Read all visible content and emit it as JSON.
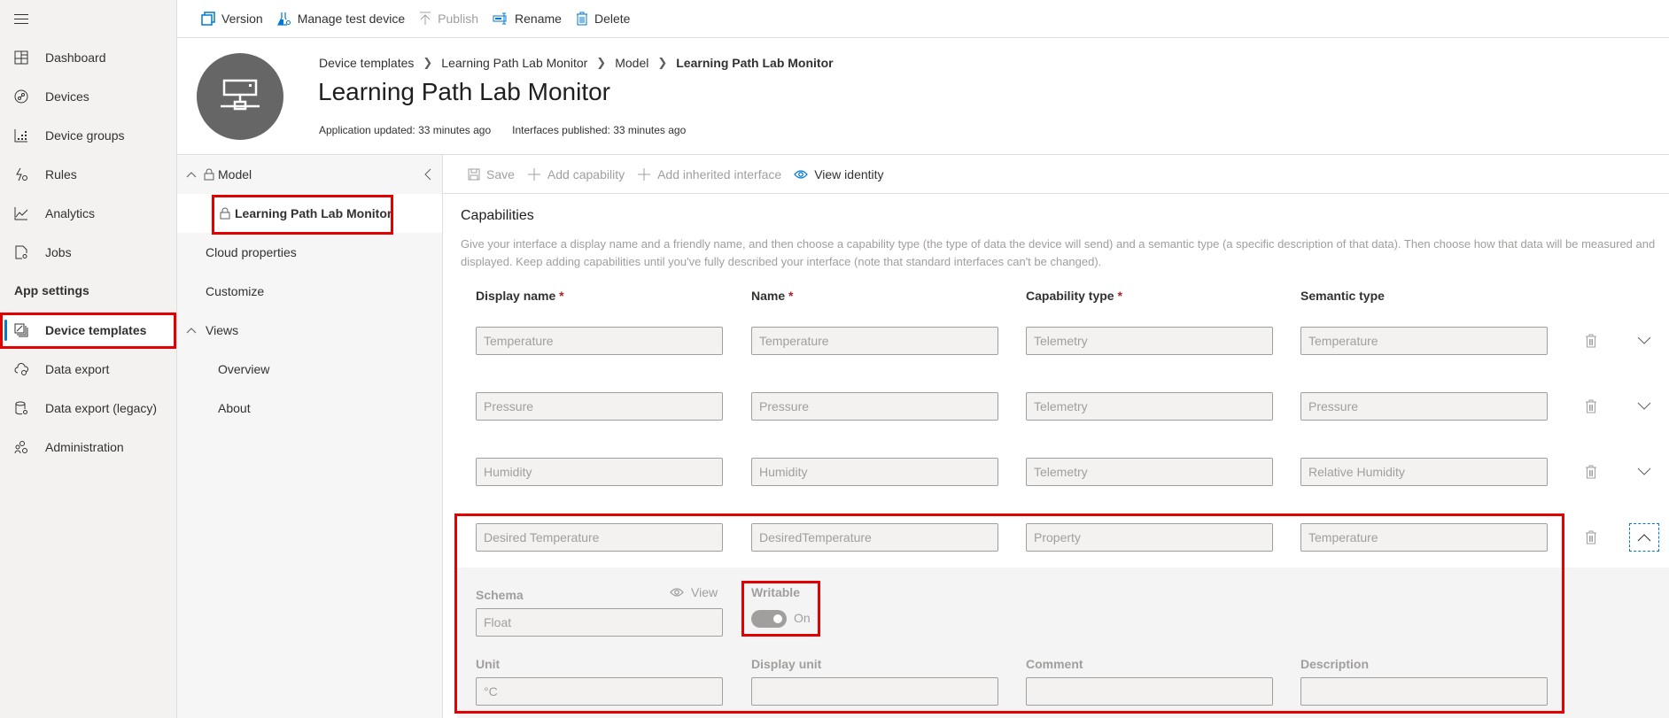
{
  "nav": {
    "items": [
      {
        "label": "Dashboard",
        "icon": "dashboard-icon"
      },
      {
        "label": "Devices",
        "icon": "devices-icon"
      },
      {
        "label": "Device groups",
        "icon": "device-groups-icon"
      },
      {
        "label": "Rules",
        "icon": "rules-icon"
      },
      {
        "label": "Analytics",
        "icon": "analytics-icon"
      },
      {
        "label": "Jobs",
        "icon": "jobs-icon"
      }
    ],
    "section_label": "App settings",
    "settings_items": [
      {
        "label": "Device templates",
        "icon": "device-templates-icon",
        "active": true
      },
      {
        "label": "Data export",
        "icon": "data-export-icon"
      },
      {
        "label": "Data export (legacy)",
        "icon": "data-export-legacy-icon"
      },
      {
        "label": "Administration",
        "icon": "administration-icon"
      }
    ]
  },
  "toolbar": {
    "version": "Version",
    "manage_test_device": "Manage test device",
    "publish": "Publish",
    "rename": "Rename",
    "delete": "Delete"
  },
  "header": {
    "breadcrumb": [
      "Device templates",
      "Learning Path Lab Monitor",
      "Model",
      "Learning Path Lab Monitor"
    ],
    "title": "Learning Path Lab Monitor",
    "app_updated": "Application updated: 33 minutes ago",
    "interfaces_published": "Interfaces published: 33 minutes ago"
  },
  "panel": {
    "model": "Model",
    "interface": "Learning Path Lab Monitor",
    "cloud_properties": "Cloud properties",
    "customize": "Customize",
    "views": "Views",
    "overview": "Overview",
    "about": "About"
  },
  "cmdbar": {
    "save": "Save",
    "add_capability": "Add capability",
    "add_inherited_interface": "Add inherited interface",
    "view_identity": "View identity"
  },
  "capabilities": {
    "title": "Capabilities",
    "description": "Give your interface a display name and a friendly name, and then choose a capability type (the type of data the device will send) and a semantic type (a specific description of that data). Then choose how that data will be measured and displayed. Keep adding capabilities until you've fully described your interface (note that standard interfaces can't be changed).",
    "columns": {
      "display_name": "Display name",
      "name": "Name",
      "capability_type": "Capability type",
      "semantic_type": "Semantic type",
      "required_mark": "*"
    },
    "rows": [
      {
        "display_name": "Temperature",
        "name": "Temperature",
        "capability_type": "Telemetry",
        "semantic_type": "Temperature",
        "expanded": false
      },
      {
        "display_name": "Pressure",
        "name": "Pressure",
        "capability_type": "Telemetry",
        "semantic_type": "Pressure",
        "expanded": false
      },
      {
        "display_name": "Humidity",
        "name": "Humidity",
        "capability_type": "Telemetry",
        "semantic_type": "Relative Humidity",
        "expanded": false
      },
      {
        "display_name": "Desired Temperature",
        "name": "DesiredTemperature",
        "capability_type": "Property",
        "semantic_type": "Temperature",
        "expanded": true
      }
    ],
    "details": {
      "schema_label": "Schema",
      "view_label": "View",
      "schema_value": "Float",
      "writable_label": "Writable",
      "writable_state": "On",
      "writable_on": true,
      "unit_label": "Unit",
      "unit_value": "°C",
      "display_unit_label": "Display unit",
      "display_unit_value": "",
      "comment_label": "Comment",
      "comment_value": "",
      "description_label": "Description",
      "description_value": ""
    }
  },
  "colors": {
    "accent": "#0078d4",
    "highlight": "#e30000",
    "required": "#a4262c",
    "disabled_text": "#a19f9d"
  }
}
